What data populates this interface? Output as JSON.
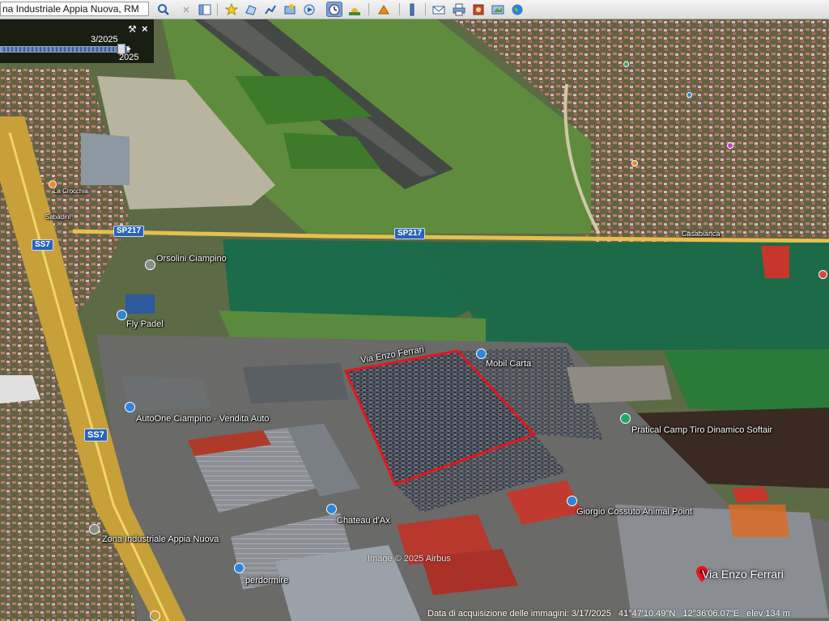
{
  "search": {
    "value": "na Industriale Appia Nuova, RM"
  },
  "toolbar": {
    "buttons": [
      "search-icon",
      "hide-sidebar-icon",
      "placemark-icon",
      "polygon-icon",
      "path-icon",
      "overlay-icon",
      "tour-icon",
      "historical-imagery-icon",
      "sunlight-icon",
      "planets-icon",
      "ruler-icon",
      "email-icon",
      "print-icon",
      "save-image-icon",
      "maps-icon",
      "earth-icon"
    ]
  },
  "timeline": {
    "current_date": "3/2025",
    "range_end": "2025"
  },
  "map_labels": {
    "via_enzo_ferrari_top": "Via Enzo Ferrari",
    "mobil_carta": "Mobil Carta",
    "pratical_camp": "Pratical Camp Tiro Dinamico Softair",
    "autoone": "AutoOne Ciampino - Vendita Auto",
    "orsolini": "Orsolini Ciampino",
    "fly_padel": "Fly Padel",
    "chateau": "Chateau d'Ax",
    "giorgio": "Giorgio Cossuto Animal Point",
    "zona": "Zona Industriale Appia Nuova",
    "perdormire": "perdormire",
    "sabadini": "Sabadini",
    "la_crocchia": "La Crocchia",
    "casabianca": "Casabianca",
    "via_enzo_ferrari_bottom": "Via Enzo Ferrari"
  },
  "road_shields": {
    "ss7_upper": "SS7",
    "ss7_lower": "SS7",
    "sp217_left": "SP217",
    "sp217_right": "SP217"
  },
  "attribution": "Image © 2025 Airbus",
  "status": {
    "date": "Data di acquisizione delle immagini: 3/17/2025",
    "lat": "41°47'10.49\"N",
    "lon": "12°36'06.07\"E",
    "elev": "elev  134 m"
  },
  "colors": {
    "highlight": "#e8151b",
    "shield": "#2a63b9",
    "pin_blue": "#2f86d8",
    "pin_green": "#24a56a"
  }
}
